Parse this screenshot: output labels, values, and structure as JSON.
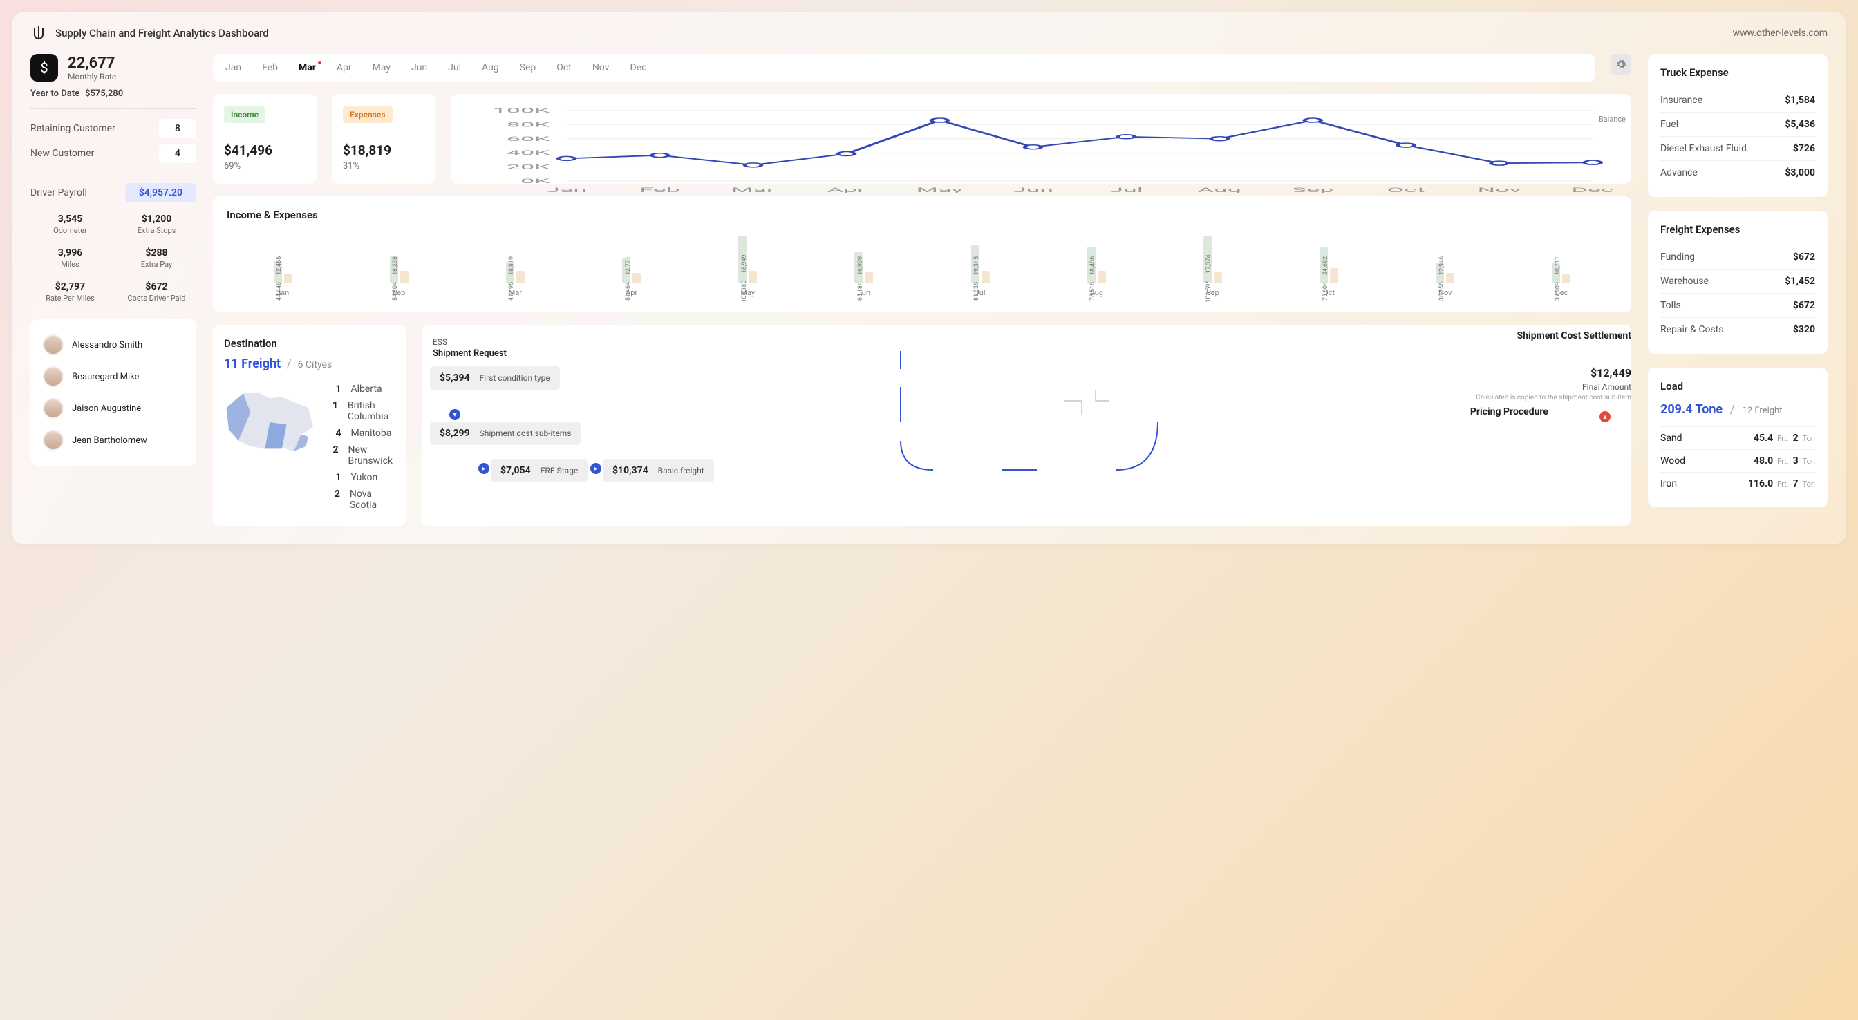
{
  "header": {
    "title": "Supply Chain and Freight Analytics Dashboard",
    "site": "www.other-levels.com"
  },
  "rate": {
    "value": "22,677",
    "label": "Monthly Rate",
    "ytd_label": "Year to Date",
    "ytd_value": "$575,280"
  },
  "customers": {
    "retain_label": "Retaining Customer",
    "retain_value": "8",
    "new_label": "New Customer",
    "new_value": "4"
  },
  "driver_payroll": {
    "label": "Driver Payroll",
    "value": "$4,957.20"
  },
  "stats": {
    "odometer_v": "3,545",
    "odometer_l": "Odometer",
    "extra_stops_v": "$1,200",
    "extra_stops_l": "Extra Stops",
    "miles_v": "3,996",
    "miles_l": "Miles",
    "extra_pay_v": "$288",
    "extra_pay_l": "Extra Pay",
    "rate_v": "$2,797",
    "rate_l": "Rate Per Miles",
    "costs_v": "$672",
    "costs_l": "Costs Driver Paid"
  },
  "people": [
    "Alessandro Smith",
    "Beauregard Mike",
    "Jaison Augustine",
    "Jean Bartholomew"
  ],
  "months": [
    "Jan",
    "Feb",
    "Mar",
    "Apr",
    "May",
    "Jun",
    "Jul",
    "Aug",
    "Sep",
    "Oct",
    "Nov",
    "Dec"
  ],
  "active_month": "Mar",
  "income_card": {
    "badge": "Income",
    "amount": "$41,496",
    "pct": "69%"
  },
  "expense_card": {
    "badge": "Expenses",
    "amount": "$18,819",
    "pct": "31%"
  },
  "balance_legend": "Balance",
  "chart_data": {
    "type": "line",
    "title": "Balance",
    "categories": [
      "Jan",
      "Feb",
      "Mar",
      "Apr",
      "May",
      "Jun",
      "Jul",
      "Aug",
      "Sep",
      "Oct",
      "Nov",
      "Dec"
    ],
    "series": [
      {
        "name": "Balance",
        "values": [
          31993,
          36566,
          22677,
          38693,
          86231,
          48272,
          62991,
          60110,
          86222,
          50912,
          25310,
          26298
        ]
      }
    ],
    "ylim": [
      0,
      100000
    ],
    "yticks": [
      "0K",
      "20K",
      "40K",
      "60K",
      "80K",
      "100K"
    ]
  },
  "ie": {
    "title": "Income & Expenses",
    "months": [
      "Jan",
      "Feb",
      "Mar",
      "Apr",
      "May",
      "Jun",
      "Jul",
      "Aug",
      "Sep",
      "Oct",
      "Nov",
      "Dec"
    ],
    "income": [
      44448,
      54804,
      41496,
      51464,
      105180,
      65184,
      81336,
      78516,
      103596,
      75604,
      38256,
      37009
    ],
    "expense": [
      12455,
      18238,
      18819,
      12771,
      18949,
      16909,
      19345,
      18406,
      17374,
      24692,
      12946,
      10711
    ],
    "income_s": [
      "44,448",
      "54,804",
      "41,496",
      "51,464",
      "105,180",
      "65,184",
      "81,336",
      "78,516",
      "103,596",
      "75,604",
      "38,256",
      "37,009"
    ],
    "expense_s": [
      "12,455",
      "18,238",
      "18,819",
      "12,771",
      "18,949",
      "16,909",
      "19,345",
      "18,406",
      "17,374",
      "24,692",
      "12,946",
      "10,711"
    ]
  },
  "dest": {
    "title": "Destination",
    "freight": "11 Freight",
    "cities": "6 Cityes",
    "rows": [
      {
        "n": "1",
        "c": "Alberta"
      },
      {
        "n": "1",
        "c": "British Columbia"
      },
      {
        "n": "4",
        "c": "Manitoba"
      },
      {
        "n": "2",
        "c": "New Brunswick"
      },
      {
        "n": "1",
        "c": "Yukon"
      },
      {
        "n": "2",
        "c": "Nova Scotia"
      }
    ]
  },
  "ship": {
    "ess": "ESS",
    "request": "Shipment Request",
    "settle": "Shipment Cost Settlement",
    "first_amt": "$5,394",
    "first_txt": "First condition type",
    "sub_amt": "$8,299",
    "sub_txt": "Shipment cost sub-items",
    "ere_amt": "$7,054",
    "ere_txt": "ERE Stage",
    "basic_amt": "$10,374",
    "basic_txt": "Basic freight",
    "final_amt": "$12,449",
    "final_l1": "Final Amount",
    "final_l2": "Calculated is copied to the shipment cost sub-item",
    "pp": "Pricing Procedure"
  },
  "truck": {
    "title": "Truck Expense",
    "rows": [
      {
        "l": "Insurance",
        "a": "$1,584"
      },
      {
        "l": "Fuel",
        "a": "$5,436"
      },
      {
        "l": "Diesel Exhaust Fluid",
        "a": "$726"
      },
      {
        "l": "Advance",
        "a": "$3,000"
      }
    ]
  },
  "freight_exp": {
    "title": "Freight Expenses",
    "rows": [
      {
        "l": "Funding",
        "a": "$672"
      },
      {
        "l": "Warehouse",
        "a": "$1,452"
      },
      {
        "l": "Tolls",
        "a": "$672"
      },
      {
        "l": "Repair & Costs",
        "a": "$320"
      }
    ]
  },
  "load": {
    "title": "Load",
    "headline": "209.4 Tone",
    "sub": "12 Freight",
    "rows": [
      {
        "m": "Sand",
        "f": "45.4",
        "t": "2"
      },
      {
        "m": "Wood",
        "f": "48.0",
        "t": "3"
      },
      {
        "m": "Iron",
        "f": "116.0",
        "t": "7"
      }
    ],
    "frt_u": "Frt.",
    "ton_u": "Ton"
  }
}
